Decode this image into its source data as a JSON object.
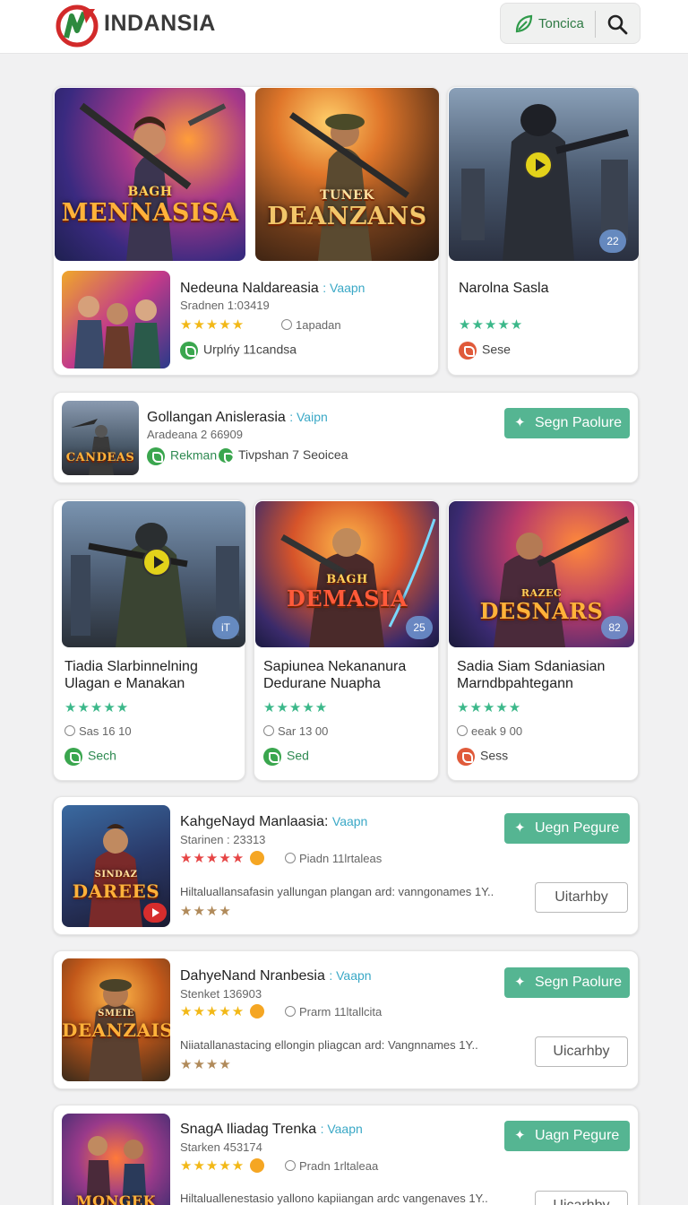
{
  "header": {
    "brand": "INDANSIA",
    "top_label": "Toncica"
  },
  "featured": {
    "art_titles": [
      "MENNASISA",
      "DEANZANS",
      ""
    ],
    "art_kickers": [
      "BAGH",
      "TUNEK",
      ""
    ],
    "badges": [
      "",
      "",
      "22"
    ],
    "left": {
      "title": "Nedeuna Naldareasia",
      "tag": ": Vaapn",
      "subtitle": "Sradnen 1:03419",
      "stars": "★★★★★",
      "meta": "1apadan",
      "chip": "Urplńy 11candsa"
    },
    "right": {
      "title": "Narolna Sasla",
      "stars": "★★★★★",
      "chip": "Sese"
    }
  },
  "row2": {
    "art_title": "CANDEAS",
    "title": "Gollangan Anislerasia",
    "tag": ": Vaipn",
    "subtitle": "Aradeana 2 66909",
    "chip1": "Rekman",
    "chip2": "Tivpshan 7 Seoicea",
    "button": "Segn Paolure"
  },
  "grid": [
    {
      "art_title": "",
      "badge": "iT",
      "line1": "Tiadia Slarbinnelning",
      "line2": "Ulagan e Manakan",
      "stars": "★★★★★",
      "meta": "Sas 16 10",
      "chip": "Sech"
    },
    {
      "art_title": "DEMASIA",
      "art_kicker": "BAGH",
      "badge": "25",
      "line1": "Sapiunea Nekananura",
      "line2": "Dedurane Nuapha",
      "stars": "★★★★★",
      "meta": "Sar 13 00",
      "chip": "Sed"
    },
    {
      "art_title": "DESNARS",
      "art_kicker": "RAZEC",
      "badge": "82",
      "line1": "Sadia Siam Sdaniasian",
      "line2": "Marndbpahtegann",
      "stars": "★★★★★",
      "meta": "eeak 9 00",
      "chip": "Sess"
    }
  ],
  "list": [
    {
      "art_title": "DAREES",
      "art_kicker": "SINDAZ",
      "title": "KahgeNayd Manlaasia:",
      "tag": "Vaapn",
      "subtitle": "Starinen : 23313",
      "stars": "★★★★★",
      "meta": "Piadn 11lrtaleas",
      "desc": "Hiltaluallansafasin yallungan plangan ard: vanngonames 1Y..",
      "rating2": "★★★★",
      "button": "Uegn Pegure",
      "outline": "Uitarhby"
    },
    {
      "art_title": "DEANZAIS",
      "art_kicker": "SMEIE",
      "title": "DahyeNand Nranbesia",
      "tag": ": Vaapn",
      "subtitle": "Stenket 136903",
      "stars": "★★★★★",
      "meta": "Prarm 11ltallcita",
      "desc": "Niiatallanastacing ellongin pliagcan ard: Vangnnames 1Y..",
      "rating2": "★★★★",
      "button": "Segn Paolure",
      "outline": "Uicarhby"
    },
    {
      "art_title": "MONGEK",
      "art_kicker": "",
      "title": "SnagA Iliadag Trenka",
      "tag": ": Vaapn",
      "subtitle": "Starken 453174",
      "stars": "★★★★★",
      "meta": "Pradn 1rltaleaa",
      "desc": "Hiltaluallenestasio yallono kapiiangan ardc vangenaves 1Y..",
      "rating2": "",
      "button": "Uagn Pegure",
      "outline": "Uicarhby"
    }
  ],
  "colors": {
    "accent_green": "#55b592",
    "star_gold": "#f2b817",
    "star_green": "#3cb88a",
    "tag_blue": "#3aa8c6"
  }
}
